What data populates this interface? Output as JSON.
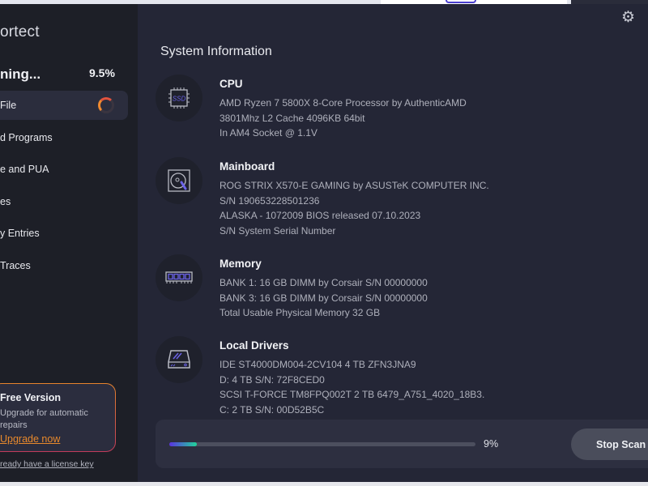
{
  "app": {
    "logo_text": "ortect"
  },
  "scan": {
    "title": "ning...",
    "percent": "9.5%"
  },
  "sidebar": {
    "items": [
      {
        "label": "File",
        "active": true
      },
      {
        "label": "d Programs"
      },
      {
        "label": "e and PUA"
      },
      {
        "label": "es"
      },
      {
        "label": "y Entries"
      },
      {
        "label": " Traces"
      }
    ]
  },
  "promo": {
    "title": "Free Version",
    "subtitle": "Upgrade for automatic repairs",
    "link": "Upgrade now",
    "license_link": "ready have a license key"
  },
  "main": {
    "title": "System Information",
    "sections": [
      {
        "icon": "cpu-icon",
        "title": "CPU",
        "lines": [
          "AMD Ryzen 7 5800X 8-Core Processor by AuthenticAMD",
          "3801Mhz L2 Cache 4096KB 64bit",
          "In AM4 Socket @ 1.1V"
        ]
      },
      {
        "icon": "hard-disk-icon",
        "title": "Mainboard",
        "lines": [
          "ROG STRIX X570-E GAMING by ASUSTeK COMPUTER INC.",
          "S/N 190653228501236",
          "ALASKA - 1072009 BIOS released 07.10.2023",
          "S/N System Serial Number"
        ]
      },
      {
        "icon": "memory-icon",
        "title": "Memory",
        "lines": [
          "BANK 1: 16 GB DIMM by Corsair S/N 00000000",
          "BANK 3: 16 GB DIMM by Corsair S/N 00000000",
          "Total Usable Physical Memory 32 GB"
        ]
      },
      {
        "icon": "drive-icon",
        "title": "Local Drivers",
        "lines": [
          "IDE ST4000DM004-2CV104 4 TB ZFN3JNA9",
          "D: 4 TB S/N: 72F8CED0",
          "SCSI T-FORCE TM8FPQ002T 2 TB 6479_A751_4020_18B3.",
          "C: 2 TB S/N: 00D52B5C"
        ]
      }
    ]
  },
  "progress": {
    "value": 9,
    "label": "9%",
    "stop_label": "Stop Scan"
  },
  "colors": {
    "accent_orange": "#e8892c",
    "progress_start": "#5a32e0",
    "progress_end": "#20d49a"
  }
}
